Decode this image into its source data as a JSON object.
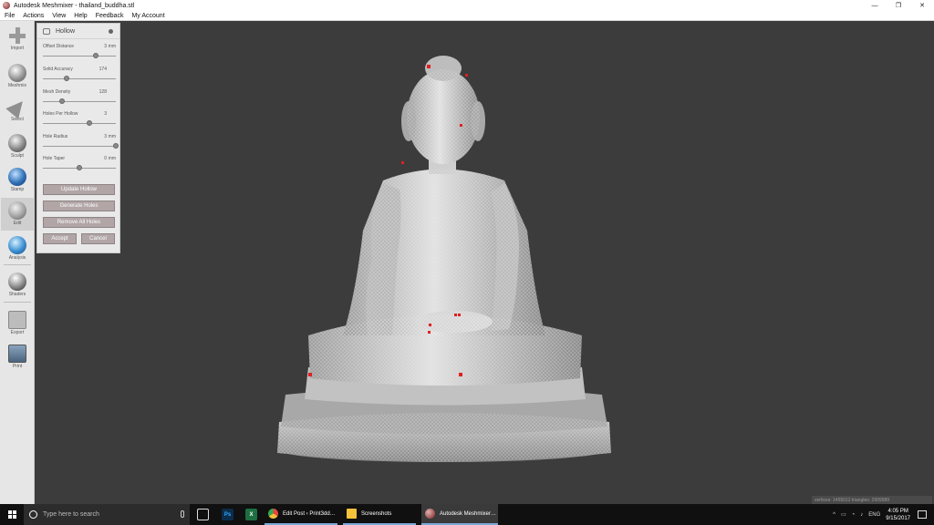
{
  "window": {
    "title": "Autodesk Meshmixer - thailand_buddha.stl",
    "controls": [
      "—",
      "❐",
      "✕"
    ]
  },
  "menu": [
    "File",
    "Actions",
    "View",
    "Help",
    "Feedback",
    "My Account"
  ],
  "toolbar": [
    {
      "label": "Import",
      "icon": "import-icon"
    },
    {
      "label": "Meshmix",
      "icon": "meshmix-icon"
    },
    {
      "label": "Select",
      "icon": "select-icon"
    },
    {
      "label": "Sculpt",
      "icon": "sculpt-icon"
    },
    {
      "label": "Stamp",
      "icon": "stamp-icon"
    },
    {
      "label": "Edit",
      "icon": "edit-icon",
      "active": true
    },
    {
      "label": "Analysis",
      "icon": "analysis-icon"
    },
    {
      "label": "Shaders",
      "icon": "shaders-icon"
    },
    {
      "label": "Export",
      "icon": "export-icon"
    },
    {
      "label": "Print",
      "icon": "print-icon"
    }
  ],
  "panel": {
    "title": "Hollow",
    "params": [
      {
        "label": "Offset Distance",
        "value": "3",
        "unit": "mm",
        "fraction": 0.72
      },
      {
        "label": "Solid Accuracy",
        "value": "174",
        "unit": "",
        "fraction": 0.33
      },
      {
        "label": "Mesh Density",
        "value": "128",
        "unit": "",
        "fraction": 0.26
      },
      {
        "label": "Holes Per Hollow",
        "value": "3",
        "unit": "",
        "fraction": 0.64
      },
      {
        "label": "Hole Radius",
        "value": "3",
        "unit": "mm",
        "fraction": 1.0
      },
      {
        "label": "Hole Taper",
        "value": "0",
        "unit": "mm",
        "fraction": 0.5
      }
    ],
    "buttons": {
      "update": "Update Hollow",
      "generate": "Generate Holes",
      "remove": "Remove All Holes",
      "accept": "Accept",
      "cancel": "Cancel"
    }
  },
  "stats": "vertices: 1455012 triangles: 2909989",
  "taskbar": {
    "search_placeholder": "Type here to search",
    "apps": [
      {
        "label": "Edit Post ‹ Print3dd…",
        "color": "#e8453c"
      },
      {
        "label": "Screenshots",
        "color": "#f3c13a"
      },
      {
        "label": "Autodesk Meshmixer…",
        "color": "#b04848",
        "active": true
      }
    ],
    "pinned": [
      "Ps",
      "X"
    ],
    "tray": {
      "lang": "ENG",
      "time": "4:05 PM",
      "date": "9/15/2017"
    }
  },
  "colors": {
    "viewport": "#3c3c3c",
    "model": "#c9c9c9",
    "hole_marker": "#e02020",
    "button": "#b1a5a6"
  }
}
